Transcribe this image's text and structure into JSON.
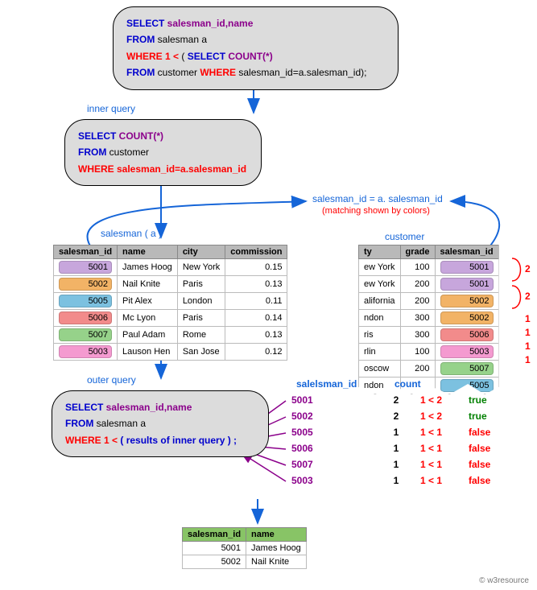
{
  "sql_main": {
    "line1a": "SELECT ",
    "line1b": "salesman_id,name",
    "line2a": "FROM ",
    "line2b": "salesman a",
    "line3a": "WHERE 1 < ",
    "line3b": " ( ",
    "line3c": "SELECT COUNT(*)",
    "line4a": "FROM ",
    "line4b": "customer  ",
    "line4c": "WHERE ",
    "line4d": "salesman_id=a.salesman_id);"
  },
  "inner_label": "inner query",
  "sql_inner": {
    "l1a": "SELECT ",
    "l1b": "COUNT(*)",
    "l2a": "FROM ",
    "l2b": "customer",
    "l3": "WHERE salesman_id=a.salesman_id"
  },
  "match_label1": "salesman_id = a. salesman_id",
  "match_label2": "(matching shown by colors)",
  "salesman_label": "salesman ( a )",
  "customer_label": "customer",
  "salesman": {
    "cols": [
      "salesman_id",
      "name",
      "city",
      "commission"
    ],
    "rows": [
      {
        "id": "5001",
        "name": "James Hoog",
        "city": "New York",
        "comm": "0.15",
        "color": "#c7a6dc"
      },
      {
        "id": "5002",
        "name": "Nail Knite",
        "city": "Paris",
        "comm": "0.13",
        "color": "#f2b366"
      },
      {
        "id": "5005",
        "name": "Pit Alex",
        "city": "London",
        "comm": "0.11",
        "color": "#7cc1e0"
      },
      {
        "id": "5006",
        "name": "Mc Lyon",
        "city": "Paris",
        "comm": "0.14",
        "color": "#f28b8b"
      },
      {
        "id": "5007",
        "name": "Paul Adam",
        "city": "Rome",
        "comm": "0.13",
        "color": "#96d28a"
      },
      {
        "id": "5003",
        "name": "Lauson Hen",
        "city": "San Jose",
        "comm": "0.12",
        "color": "#f49ad0"
      }
    ]
  },
  "customer": {
    "cols": [
      "ty",
      "grade",
      "salesman_id"
    ],
    "rows": [
      {
        "city": "ew York",
        "grade": "100",
        "sid": "5001",
        "color": "#c7a6dc"
      },
      {
        "city": "ew York",
        "grade": "200",
        "sid": "5001",
        "color": "#c7a6dc"
      },
      {
        "city": "alifornia",
        "grade": "200",
        "sid": "5002",
        "color": "#f2b366"
      },
      {
        "city": "ndon",
        "grade": "300",
        "sid": "5002",
        "color": "#f2b366"
      },
      {
        "city": "ris",
        "grade": "300",
        "sid": "5006",
        "color": "#f28b8b"
      },
      {
        "city": "rlin",
        "grade": "100",
        "sid": "5003",
        "color": "#f49ad0"
      },
      {
        "city": "oscow",
        "grade": "200",
        "sid": "5007",
        "color": "#96d28a"
      },
      {
        "city": "ndon",
        "grade": "",
        "sid": "5005",
        "color": "#7cc1e0"
      }
    ]
  },
  "brackets": [
    "2",
    "2",
    "1",
    "1",
    "1",
    "1"
  ],
  "outer_label": "outer query",
  "sql_outer": {
    "l1a": "SELECT ",
    "l1b": "salesman_id,name",
    "l2a": "FROM ",
    "l2b": "salesman a",
    "l3a": "WHERE 1 < ",
    "l3b": " ( results of inner query ) ;"
  },
  "eval_header": {
    "c1": "salelsman_id",
    "c2": "count"
  },
  "eval_rows": [
    {
      "id": "5001",
      "count": "2",
      "cmp": "1 < 2",
      "res": "true"
    },
    {
      "id": "5002",
      "count": "2",
      "cmp": "1 < 2",
      "res": "true"
    },
    {
      "id": "5005",
      "count": "1",
      "cmp": "1 < 1",
      "res": "false"
    },
    {
      "id": "5006",
      "count": "1",
      "cmp": "1 < 1",
      "res": "false"
    },
    {
      "id": "5007",
      "count": "1",
      "cmp": "1 < 1",
      "res": "false"
    },
    {
      "id": "5003",
      "count": "1",
      "cmp": "1 < 1",
      "res": "false"
    }
  ],
  "result": {
    "cols": [
      "salesman_id",
      "name"
    ],
    "rows": [
      {
        "id": "5001",
        "name": "James Hoog"
      },
      {
        "id": "5002",
        "name": "Nail Knite"
      }
    ]
  },
  "footer": "© w3resource"
}
